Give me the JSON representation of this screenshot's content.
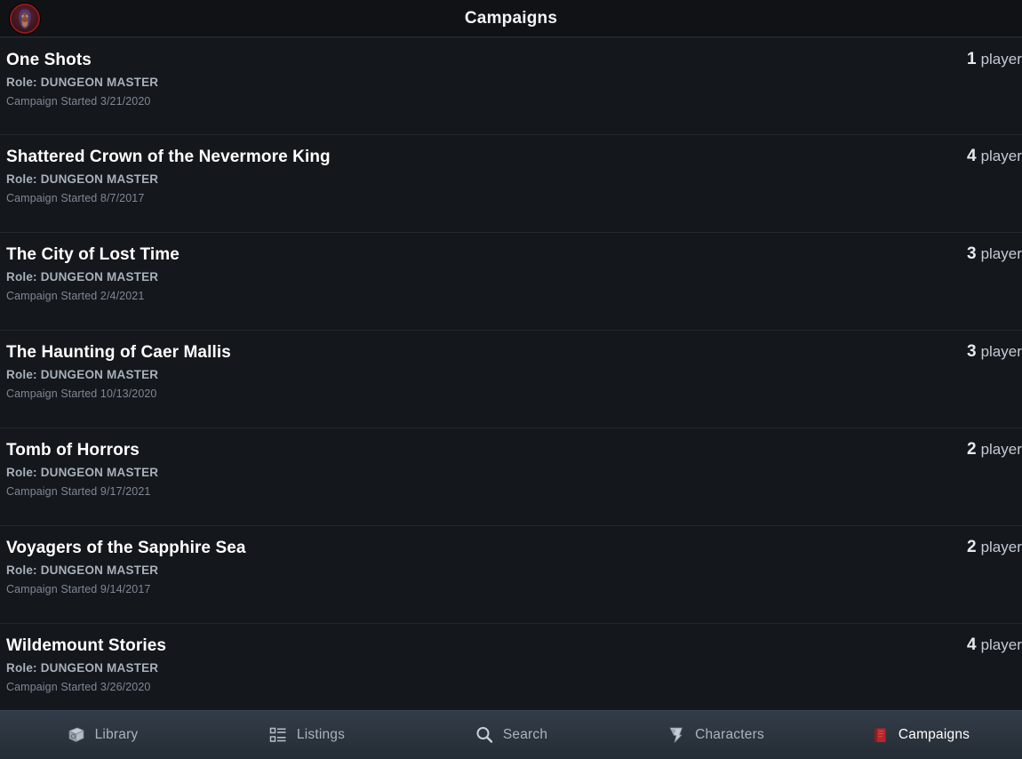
{
  "header": {
    "title": "Campaigns",
    "avatar_name": "user-avatar",
    "avatar_alt": "character portrait"
  },
  "colors": {
    "background": "#14171c",
    "header_bg": "#101216",
    "divider": "#23282f",
    "title_text": "#ffffff",
    "role_text": "#a8b0ba",
    "date_text": "#7f8793",
    "players_text": "#c3cad3",
    "tabbar_bg": "#2c353f",
    "tab_inactive": "#aab3bd",
    "tab_active": "#ffffff",
    "accent_red": "#c0392b",
    "avatar_ring": "#8e1b1b"
  },
  "list": {
    "players_suffix": "players",
    "players_suffix_singular": "player",
    "campaigns": [
      {
        "title": "One Shots",
        "role": "Role: DUNGEON MASTER",
        "started": "Campaign Started 3/21/2020",
        "players_count": "1",
        "players_label": "player"
      },
      {
        "title": "Shattered Crown of the Nevermore King",
        "role": "Role: DUNGEON MASTER",
        "started": "Campaign Started 8/7/2017",
        "players_count": "4",
        "players_label": "players"
      },
      {
        "title": "The City of Lost Time",
        "role": "Role: DUNGEON MASTER",
        "started": "Campaign Started 2/4/2021",
        "players_count": "3",
        "players_label": "players"
      },
      {
        "title": "The Haunting of Caer Mallis",
        "role": "Role: DUNGEON MASTER",
        "started": "Campaign Started 10/13/2020",
        "players_count": "3",
        "players_label": "players"
      },
      {
        "title": "Tomb of Horrors",
        "role": "Role: DUNGEON MASTER",
        "started": "Campaign Started 9/17/2021",
        "players_count": "2",
        "players_label": "players"
      },
      {
        "title": "Voyagers of the Sapphire Sea",
        "role": "Role: DUNGEON MASTER",
        "started": "Campaign Started 9/14/2017",
        "players_count": "2",
        "players_label": "players"
      },
      {
        "title": "Wildemount Stories",
        "role": "Role: DUNGEON MASTER",
        "started": "Campaign Started 3/26/2020",
        "players_count": "4",
        "players_label": "players"
      }
    ]
  },
  "tabbar": {
    "tabs": [
      {
        "label": "Library",
        "icon": "book-stack-icon",
        "active": false
      },
      {
        "label": "Listings",
        "icon": "list-grid-icon",
        "active": false
      },
      {
        "label": "Search",
        "icon": "search-icon",
        "active": false
      },
      {
        "label": "Characters",
        "icon": "banner-icon",
        "active": false
      },
      {
        "label": "Campaigns",
        "icon": "red-book-icon",
        "active": true
      }
    ]
  }
}
